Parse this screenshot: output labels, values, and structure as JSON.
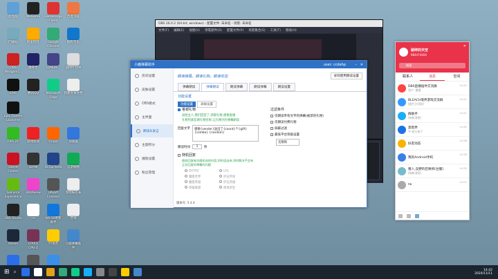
{
  "desktop_icons": [
    {
      "label": "此电脑",
      "color": "#5fa0d8",
      "col": 0,
      "row": 0
    },
    {
      "label": "WeGame",
      "color": "#222",
      "col": 1,
      "row": 0
    },
    {
      "label": "GameForge\nClient",
      "color": "#d33",
      "col": 2,
      "row": 0
    },
    {
      "label": "百度浏览",
      "color": "#e74",
      "col": 3,
      "row": 0
    },
    {
      "label": "回收站",
      "color": "#7ab",
      "col": 0,
      "row": 1
    },
    {
      "label": "阿里旺旺",
      "color": "#fa0",
      "col": 1,
      "row": 1
    },
    {
      "label": "Google\nChrome",
      "color": "#3a7",
      "col": 2,
      "row": 1
    },
    {
      "label": "酷狗音乐",
      "color": "#17c",
      "col": 3,
      "row": 1
    },
    {
      "label": "OBS\nWargami...",
      "color": "#c22",
      "col": 0,
      "row": 2
    },
    {
      "label": "魔兽世",
      "color": "#226",
      "col": 1,
      "row": 2
    },
    {
      "label": "LDMulti...",
      "color": "#448",
      "col": 2,
      "row": 2
    },
    {
      "label": "战网计划书",
      "color": "#ddd",
      "col": 3,
      "row": 2
    },
    {
      "label": "EPIC",
      "color": "#111",
      "col": 0,
      "row": 3
    },
    {
      "label": "腾讯QQ",
      "color": "#222",
      "col": 1,
      "row": 3
    },
    {
      "label": "Microsoft\nEdge",
      "color": "#1c8",
      "col": 2,
      "row": 3
    },
    {
      "label": "新建文本文档",
      "color": "#eee",
      "col": 3,
      "row": 3
    },
    {
      "label": "Epic Games\nLauncher",
      "color": "#111",
      "col": 0,
      "row": 3.9
    },
    {
      "label": "FIFA 21",
      "color": "#3b2",
      "col": 0,
      "row": 4.9
    },
    {
      "label": "游戏加加",
      "color": "#e22",
      "col": 1,
      "row": 4.9
    },
    {
      "label": "Origin",
      "color": "#f60",
      "col": 2,
      "row": 4.9
    },
    {
      "label": "加速器",
      "color": "#37d",
      "col": 3,
      "row": 4.9
    },
    {
      "label": "Game\nCenter",
      "color": "#c12",
      "col": 0,
      "row": 5.9
    },
    {
      "label": "GIANI",
      "color": "#333",
      "col": 1,
      "row": 5.9
    },
    {
      "label": "SSTap-beta",
      "color": "#248",
      "col": 2,
      "row": 5.9
    },
    {
      "label": "迅游网络",
      "color": "#1a5",
      "col": 3,
      "row": 5.9
    },
    {
      "label": "GeForce\nExperience",
      "color": "#6b1",
      "col": 0,
      "row": 6.9
    },
    {
      "label": "360Aview",
      "color": "#e4c",
      "col": 1,
      "row": 6.9
    },
    {
      "label": "UAsoft\nConnect",
      "color": "#555",
      "col": 2,
      "row": 6.9
    },
    {
      "label": "游戏报名表",
      "color": "#eee",
      "col": 3,
      "row": 6.9
    },
    {
      "label": "OBS Studio",
      "color": "#222",
      "col": 0,
      "row": 7.9
    },
    {
      "label": "ce",
      "color": "#fff",
      "col": 1,
      "row": 7.9
    },
    {
      "label": "Win10更新\n助手",
      "color": "#17d",
      "col": 2,
      "row": 7.9
    },
    {
      "label": "营销",
      "color": "#eee",
      "col": 3,
      "row": 7.9
    },
    {
      "label": "Steam",
      "color": "#1b2838",
      "col": 0,
      "row": 8.9
    },
    {
      "label": "CPUID\nCPU-Z",
      "color": "#735",
      "col": 1,
      "row": 8.9
    },
    {
      "label": "YY语音",
      "color": "#fc0",
      "col": 2,
      "row": 8.9
    },
    {
      "label": "小鹿弹幕助\n手",
      "color": "#48c",
      "col": 3,
      "row": 8.9
    },
    {
      "label": "ToDesk",
      "color": "#2a6fe8",
      "col": 0,
      "row": 9.9
    },
    {
      "label": "drSpy",
      "color": "#555",
      "col": 1,
      "row": 9.9
    },
    {
      "label": "百度网盘",
      "color": "#3a8fe8",
      "col": 2,
      "row": 9.9
    }
  ],
  "obs": {
    "title": "OBS 26.0.2 (64-bit, windows) - 配置文件: 未命名 - 场景: 未命名",
    "menu": [
      "文件(F)",
      "编辑(E)",
      "视图(V)",
      "停靠部件(D)",
      "配置文件(P)",
      "场景集合(S)",
      "工具(T)",
      "帮助(H)"
    ]
  },
  "gui": {
    "title": "小鹿弹幕助手",
    "user": "user: ccdehp",
    "sidebar": [
      "房间设置",
      "皮肤设置",
      "OBS模式",
      "主界面",
      "朗读&发言",
      "主题积分",
      "播放设置",
      "粉丝管理"
    ],
    "active_nav": 4,
    "banner": "朗读弹幕、朗读礼物、朗读欢迎",
    "top_button": "如何使用朗读设置",
    "tabs": [
      "弹幕朗读",
      "弹幕朗读",
      "朗读弹幕",
      "朗读弹幕",
      "朗读设置"
    ],
    "active_tab": 1,
    "subtabs": [
      "功能设置",
      "高级设置"
    ],
    "section_left": "功能设置",
    "gift_label": "答谢礼物",
    "gift_note1": "送给主人,我们回答了,领取礼物,感谢直播",
    "gift_note2": "礼物列表答谢礼物名称,让礼物列为弹幕朗读",
    "reply_label": "回复文字",
    "reply_text": "感谢{sender}送出了{count}个{gift}\n{combo} {random}",
    "interval_label": "朗读时间",
    "interval_value": "1",
    "interval_unit": "秒",
    "random_label": "随机回复",
    "random_note": "随机回复每次随机选择内容,同时读出来,同时解决不会有\n正在回复的弹幕的问题",
    "random_options": [
      [
        "DOTA2",
        "LOL"
      ],
      [
        "魔兽世界",
        "炉石传说"
      ],
      [
        "魔兽英雄",
        "炉石英雄"
      ],
      [
        "英雄联盟",
        "绝地求生"
      ]
    ],
    "section_right": "过滤条件",
    "filters": [
      "仅朗读带有文字的弹幕(被禁的礼物)",
      "仅朗读付费礼物",
      "屏蔽过滤",
      "最低平台等级设置"
    ],
    "select_value": "无限制",
    "version": "版本号: 5.4.4"
  },
  "qq": {
    "nick": "破碎的天空",
    "sign": "684474404",
    "search": "搜索",
    "tabs": [
      "联系人",
      "消息",
      "空间"
    ],
    "active_tab": 1,
    "chats": [
      {
        "name": "DBS直播插件交流群",
        "msg": "用户: 看看",
        "time": "14:42",
        "color": "#f44"
      },
      {
        "name": "BLEACH境界游戏交流群",
        "msg": "[图片]大家好",
        "time": "14:41",
        "color": "#39f"
      },
      {
        "name": "群助手",
        "msg": "[有新消息]",
        "time": "14:41",
        "color": "#1aaef8"
      },
      {
        "name": "黑暗界",
        "msg": "平:老大来了",
        "time": "14:40",
        "color": "#1a73e8"
      },
      {
        "name": "好友动态",
        "msg": "",
        "time": "14:38",
        "color": "#f8b400"
      },
      {
        "name": "我的Android手机",
        "msg": "",
        "time": "14:36",
        "color": "#3a7ee8"
      },
      {
        "name": "猪人,竞野的召唤师[台服]",
        "msg": "[有新消息]",
        "time": "14:30",
        "color": "#7bc"
      },
      {
        "name": "hk",
        "msg": "",
        "time": "14:22",
        "color": "#aaa"
      }
    ]
  },
  "taskbar": {
    "time": "14:42",
    "date": "2020/11/11",
    "icons": [
      "#2a6fe8",
      "#fff",
      "#e3a21a",
      "#3a7",
      "#1c8",
      "#1aaef8",
      "#888",
      "#444",
      "#fc0",
      "#48c"
    ]
  }
}
